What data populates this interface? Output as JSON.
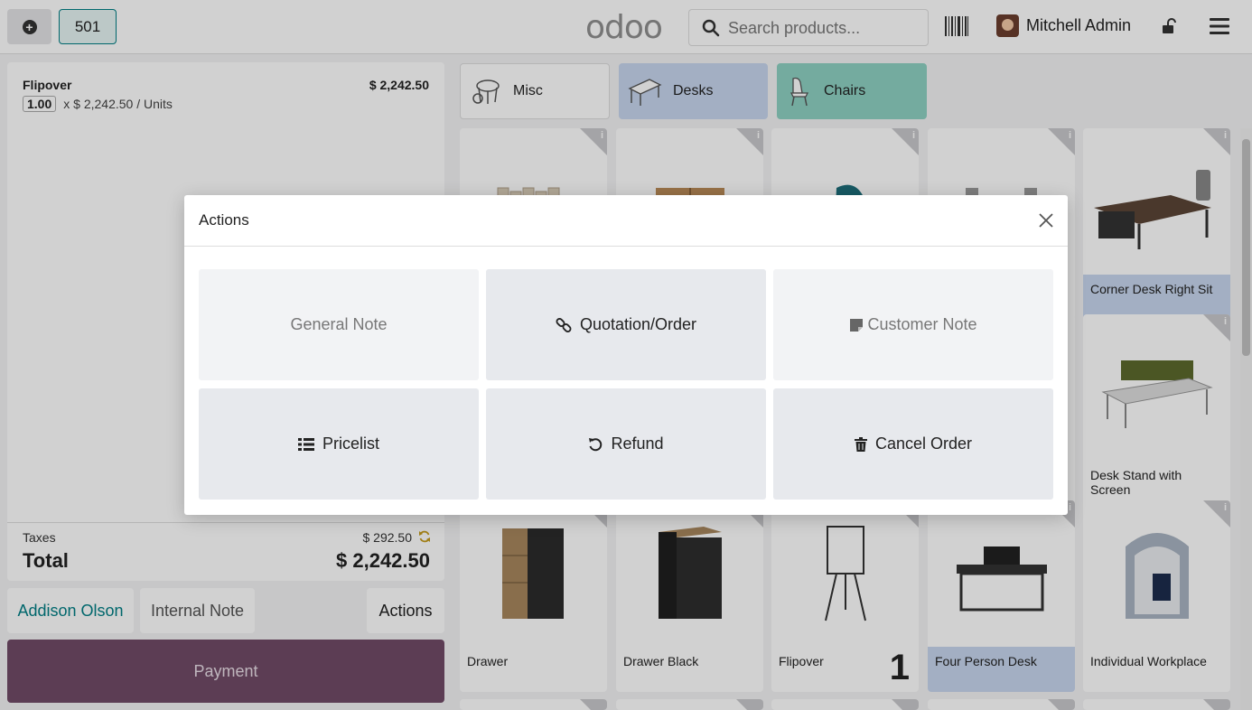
{
  "header": {
    "order_number": "501",
    "logo_text": "odoo",
    "search_placeholder": "Search products...",
    "user_name": "Mitchell Admin"
  },
  "order": {
    "lines": [
      {
        "name": "Flipover",
        "price": "$ 2,242.50",
        "qty": "1.00",
        "unit_detail": "x $ 2,242.50 / Units"
      }
    ],
    "taxes_label": "Taxes",
    "taxes_value": "$ 292.50",
    "total_label": "Total",
    "total_value": "$ 2,242.50"
  },
  "controls": {
    "customer_label": "Addison Olson",
    "internal_note_label": "Internal Note",
    "actions_label": "Actions",
    "payment_label": "Payment"
  },
  "categories": [
    {
      "label": "Misc",
      "icon": "misc-category-icon"
    },
    {
      "label": "Desks",
      "icon": "desk-category-icon"
    },
    {
      "label": "Chairs",
      "icon": "chair-category-icon"
    }
  ],
  "products": [
    {
      "name": "Corner Desk Right Sit"
    },
    {
      "name": "Desk Stand with Screen"
    },
    {
      "name": "Drawer"
    },
    {
      "name": "Drawer Black"
    },
    {
      "name": "Flipover",
      "qty": "1"
    },
    {
      "name": "Four Person Desk"
    },
    {
      "name": "Individual Workplace"
    }
  ],
  "modal": {
    "title": "Actions",
    "actions": [
      {
        "label": "General Note",
        "icon": ""
      },
      {
        "label": "Quotation/Order",
        "icon": "link-icon"
      },
      {
        "label": "Customer Note",
        "icon": "sticky-note-icon"
      },
      {
        "label": "Pricelist",
        "icon": "list-icon"
      },
      {
        "label": "Refund",
        "icon": "undo-icon"
      },
      {
        "label": "Cancel Order",
        "icon": "trash-icon"
      }
    ]
  },
  "colors": {
    "brand": "#714b67",
    "accent": "#017e84",
    "desks_category": "#c7d6ee",
    "chairs_category": "#8ed1c3"
  }
}
